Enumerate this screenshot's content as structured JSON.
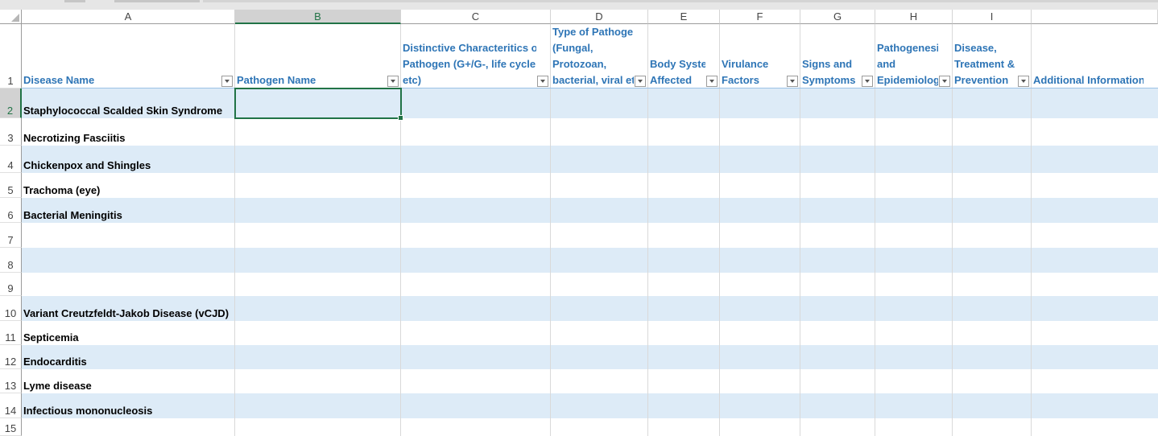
{
  "columns": [
    "A",
    "B",
    "C",
    "D",
    "E",
    "F",
    "G",
    "H",
    "I"
  ],
  "selected_column": "B",
  "header_row": {
    "A": [
      "Disease Name"
    ],
    "B": [
      "Pathogen Name"
    ],
    "C": [
      "Distinctive Characteritics of",
      "Pathogen (G+/G-, life cycle",
      "etc)"
    ],
    "D": [
      "Type of Pathogen",
      "(Fungal,",
      "Protozoan,",
      "bacterial, viral etc"
    ],
    "E": [
      "Body System",
      "Affected"
    ],
    "F": [
      "Virulance",
      "Factors"
    ],
    "G": [
      "Signs and",
      "Symptoms"
    ],
    "H": [
      "Pathogenesis",
      "and",
      "Epidemiology"
    ],
    "I": [
      "Disease,",
      "Treatment &",
      "Prevention"
    ],
    "J": [
      "Additional Information"
    ]
  },
  "row_numbers": [
    "1",
    "2",
    "3",
    "4",
    "5",
    "6",
    "7",
    "8",
    "9",
    "10",
    "11",
    "12",
    "13",
    "14",
    "15"
  ],
  "selected_row": "2",
  "diseases": [
    "Staphylococcal Scalded Skin Syndrome",
    "Necrotizing Fasciitis",
    "Chickenpox and Shingles",
    "Trachoma (eye)",
    "Bacterial Meningitis",
    "",
    "",
    "",
    "Variant Creutzfeldt-Jakob Disease (vCJD)",
    "Septicemia",
    "Endocarditis",
    "Lyme disease",
    "Infectious mononucleosis",
    ""
  ],
  "colors": {
    "header_text": "#2e75b6",
    "band_blue": "#ddebf7",
    "selection_green": "#217346"
  }
}
